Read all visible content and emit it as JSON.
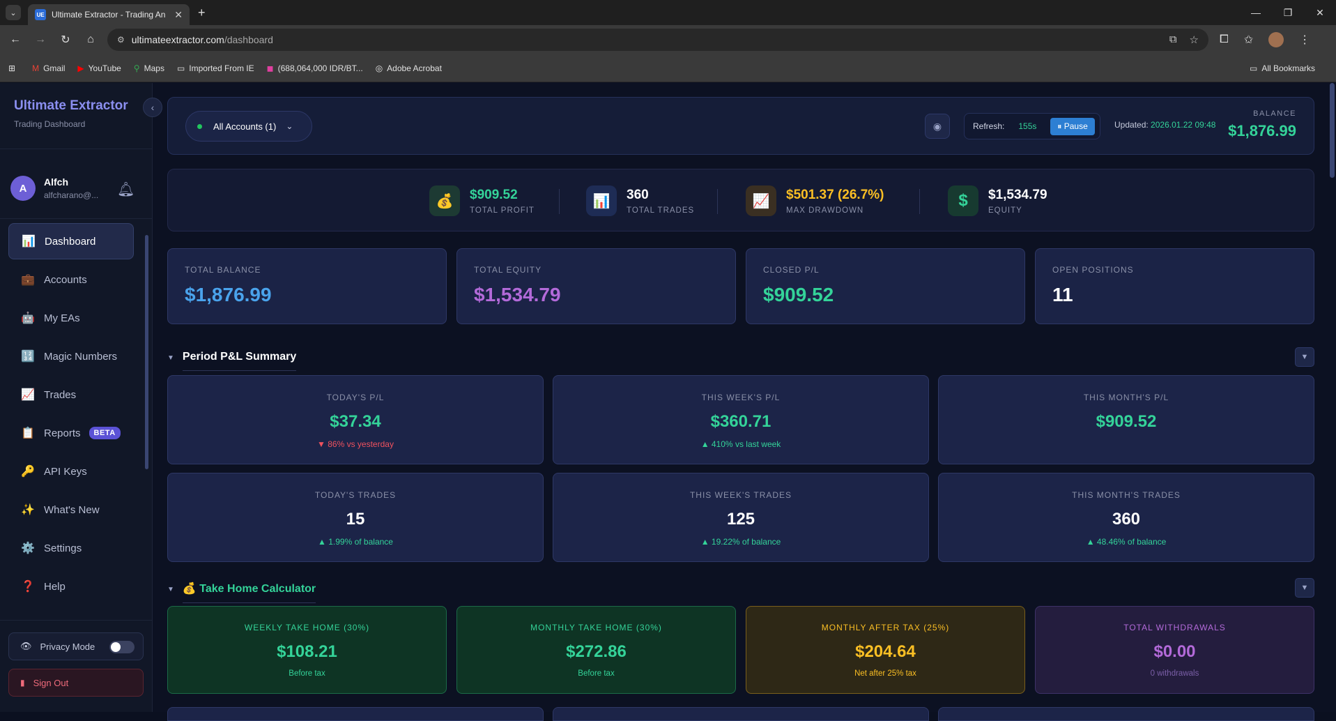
{
  "browser": {
    "tab_title": "Ultimate Extractor - Trading An",
    "tab_favicon": "UE",
    "url_host": "ultimateextractor.com",
    "url_path": "/dashboard",
    "bookmarks": [
      {
        "label": "Gmail",
        "icon": "gmail-icon"
      },
      {
        "label": "YouTube",
        "icon": "youtube-icon"
      },
      {
        "label": "Maps",
        "icon": "maps-icon"
      },
      {
        "label": "Imported From IE",
        "icon": "folder-icon"
      },
      {
        "label": "(688,064,000 IDR/BT...",
        "icon": "exchange-icon"
      },
      {
        "label": "Adobe Acrobat",
        "icon": "acrobat-icon"
      }
    ],
    "all_bookmarks": "All Bookmarks"
  },
  "sidebar": {
    "brand": "Ultimate Extractor",
    "subtitle": "Trading Dashboard",
    "user_initial": "A",
    "user_name": "Alfch",
    "user_email": "alfcharano@...",
    "items": [
      {
        "label": "Dashboard",
        "icon": "📊",
        "active": true
      },
      {
        "label": "Accounts",
        "icon": "💼"
      },
      {
        "label": "My EAs",
        "icon": "🤖"
      },
      {
        "label": "Magic Numbers",
        "icon": "🔢"
      },
      {
        "label": "Trades",
        "icon": "📈"
      },
      {
        "label": "Reports",
        "icon": "📋",
        "badge": "BETA"
      },
      {
        "label": "API Keys",
        "icon": "🔑"
      },
      {
        "label": "What's New",
        "icon": "✨"
      },
      {
        "label": "Settings",
        "icon": "⚙️"
      },
      {
        "label": "Help",
        "icon": "❓"
      }
    ],
    "privacy_label": "Privacy Mode",
    "signout_label": "Sign Out"
  },
  "topbar": {
    "account_selector": "All Accounts (1)",
    "refresh_label": "Refresh:",
    "refresh_seconds": "155s",
    "pause_label": "⏸ Pause",
    "updated_label": "Updated:",
    "updated_value": "2026.01.22 09:48",
    "balance_label": "BALANCE",
    "balance_value": "$1,876.99"
  },
  "stats": {
    "profit_value": "$909.52",
    "profit_label": "TOTAL PROFIT",
    "trades_value": "360",
    "trades_label": "TOTAL TRADES",
    "drawdown_value": "$501.37 (26.7%)",
    "drawdown_label": "MAX DRAWDOWN",
    "equity_value": "$1,534.79",
    "equity_label": "EQUITY"
  },
  "summary_cards": [
    {
      "label": "TOTAL BALANCE",
      "value": "$1,876.99"
    },
    {
      "label": "TOTAL EQUITY",
      "value": "$1,534.79"
    },
    {
      "label": "CLOSED P/L",
      "value": "$909.52"
    },
    {
      "label": "OPEN POSITIONS",
      "value": "11"
    }
  ],
  "period": {
    "title": "Period P&L Summary",
    "pl_cards": [
      {
        "label": "TODAY'S P/L",
        "value": "$37.34",
        "sub": "▼ 86% vs yesterday"
      },
      {
        "label": "THIS WEEK'S P/L",
        "value": "$360.71",
        "sub": "▲ 410% vs last week"
      },
      {
        "label": "THIS MONTH'S P/L",
        "value": "$909.52",
        "sub": ""
      }
    ],
    "trade_cards": [
      {
        "label": "TODAY'S TRADES",
        "value": "15",
        "sub": "▲ 1.99% of balance"
      },
      {
        "label": "THIS WEEK'S TRADES",
        "value": "125",
        "sub": "▲ 19.22% of balance"
      },
      {
        "label": "THIS MONTH'S TRADES",
        "value": "360",
        "sub": "▲ 48.46% of balance"
      }
    ]
  },
  "takehome": {
    "title": "Take Home Calculator",
    "title_icon": "💰",
    "cards": [
      {
        "label": "WEEKLY TAKE HOME (30%)",
        "value": "$108.21",
        "sub": "Before tax"
      },
      {
        "label": "MONTHLY TAKE HOME (30%)",
        "value": "$272.86",
        "sub": "Before tax"
      },
      {
        "label": "MONTHLY AFTER TAX (25%)",
        "value": "$204.64",
        "sub": "Net after 25% tax"
      },
      {
        "label": "TOTAL WITHDRAWALS",
        "value": "$0.00",
        "sub": "0 withdrawals"
      }
    ]
  }
}
